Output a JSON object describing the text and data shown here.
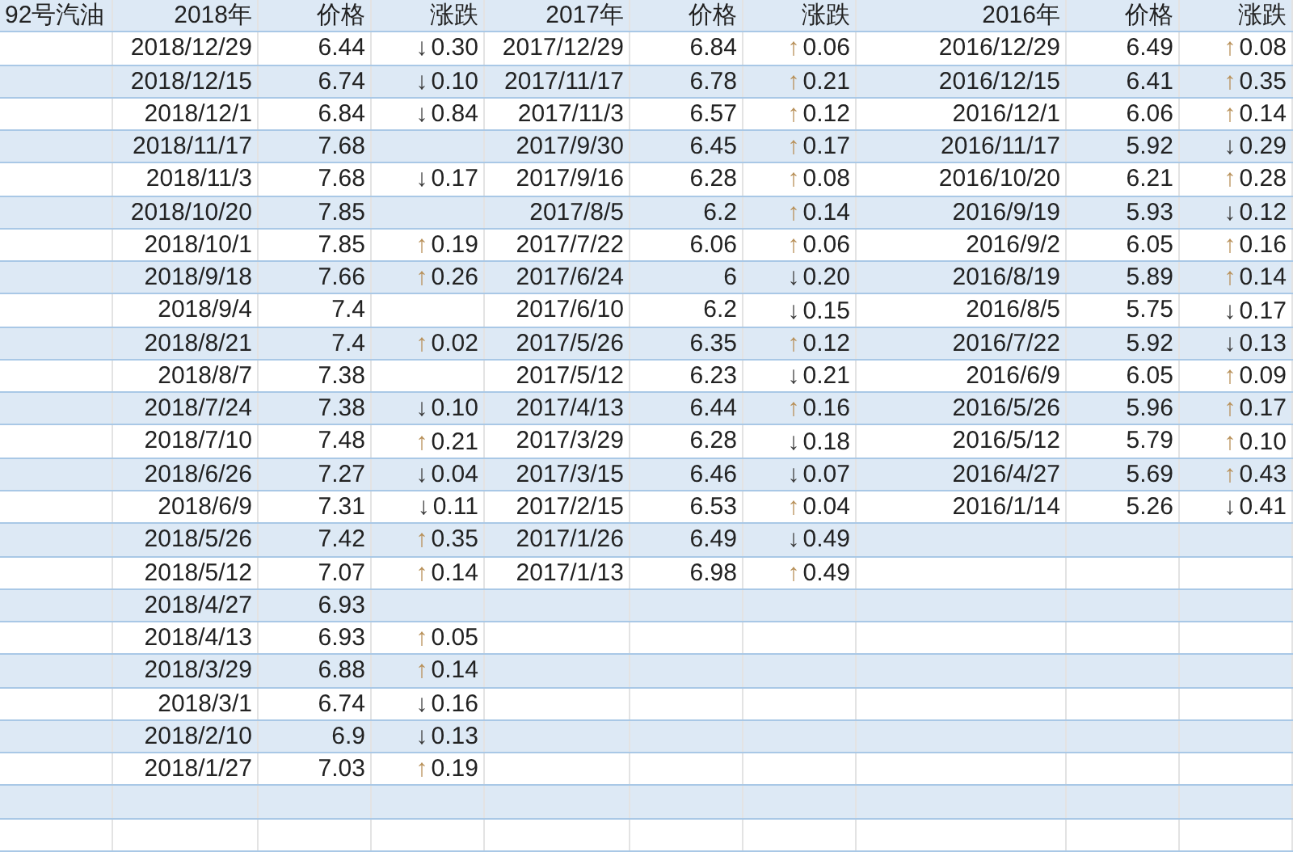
{
  "corner_label": "92号汽油",
  "sections": [
    {
      "date_header": "2018年",
      "price_header": "价格",
      "change_header": "涨跌",
      "rows": [
        {
          "date": "2018/12/29",
          "price": "6.44",
          "change": {
            "kind": "down",
            "arrow": "↓",
            "value": "0.30"
          }
        },
        {
          "date": "2018/12/15",
          "price": "6.74",
          "change": {
            "kind": "down",
            "arrow": "↓",
            "value": "0.10"
          }
        },
        {
          "date": "2018/12/1",
          "price": "6.84",
          "change": {
            "kind": "down",
            "arrow": "↓",
            "value": "0.84"
          }
        },
        {
          "date": "2018/11/17",
          "price": "7.68"
        },
        {
          "date": "2018/11/3",
          "price": "7.68",
          "change": {
            "kind": "down",
            "arrow": "↓",
            "value": "0.17"
          }
        },
        {
          "date": "2018/10/20",
          "price": "7.85"
        },
        {
          "date": "2018/10/1",
          "price": "7.85",
          "change": {
            "kind": "up",
            "arrow": "↑",
            "value": "0.19"
          }
        },
        {
          "date": "2018/9/18",
          "price": "7.66",
          "change": {
            "kind": "up",
            "arrow": "↑",
            "value": "0.26"
          }
        },
        {
          "date": "2018/9/4",
          "price": "7.4"
        },
        {
          "date": "2018/8/21",
          "price": "7.4",
          "change": {
            "kind": "up",
            "arrow": "↑",
            "value": "0.02"
          }
        },
        {
          "date": "2018/8/7",
          "price": "7.38"
        },
        {
          "date": "2018/7/24",
          "price": "7.38",
          "change": {
            "kind": "down",
            "arrow": "↓",
            "value": "0.10"
          }
        },
        {
          "date": "2018/7/10",
          "price": "7.48",
          "change": {
            "kind": "up",
            "arrow": "↑",
            "value": "0.21"
          }
        },
        {
          "date": "2018/6/26",
          "price": "7.27",
          "change": {
            "kind": "down",
            "arrow": "↓",
            "value": "0.04"
          }
        },
        {
          "date": "2018/6/9",
          "price": "7.31",
          "change": {
            "kind": "down",
            "arrow": "↓",
            "value": "0.11"
          }
        },
        {
          "date": "2018/5/26",
          "price": "7.42",
          "change": {
            "kind": "up",
            "arrow": "↑",
            "value": "0.35"
          }
        },
        {
          "date": "2018/5/12",
          "price": "7.07",
          "change": {
            "kind": "up",
            "arrow": "↑",
            "value": "0.14"
          }
        },
        {
          "date": "2018/4/27",
          "price": "6.93"
        },
        {
          "date": "2018/4/13",
          "price": "6.93",
          "change": {
            "kind": "up",
            "arrow": "↑",
            "value": "0.05"
          }
        },
        {
          "date": "2018/3/29",
          "price": "6.88",
          "change": {
            "kind": "up",
            "arrow": "↑",
            "value": "0.14"
          }
        },
        {
          "date": "2018/3/1",
          "price": "6.74",
          "change": {
            "kind": "down",
            "arrow": "↓",
            "value": "0.16"
          }
        },
        {
          "date": "2018/2/10",
          "price": "6.9",
          "change": {
            "kind": "down",
            "arrow": "↓",
            "value": "0.13"
          }
        },
        {
          "date": "2018/1/27",
          "price": "7.03",
          "change": {
            "kind": "up",
            "arrow": "↑",
            "value": "0.19"
          }
        }
      ]
    },
    {
      "date_header": "2017年",
      "price_header": "价格",
      "change_header": "涨跌",
      "rows": [
        {
          "date": "2017/12/29",
          "price": "6.84",
          "change": {
            "kind": "up",
            "arrow": "↑",
            "value": "0.06"
          }
        },
        {
          "date": "2017/11/17",
          "price": "6.78",
          "change": {
            "kind": "up",
            "arrow": "↑",
            "value": "0.21"
          }
        },
        {
          "date": "2017/11/3",
          "price": "6.57",
          "change": {
            "kind": "up",
            "arrow": "↑",
            "value": "0.12"
          }
        },
        {
          "date": "2017/9/30",
          "price": "6.45",
          "change": {
            "kind": "up",
            "arrow": "↑",
            "value": "0.17"
          }
        },
        {
          "date": "2017/9/16",
          "price": "6.28",
          "change": {
            "kind": "up",
            "arrow": "↑",
            "value": "0.08"
          }
        },
        {
          "date": "2017/8/5",
          "price": "6.2",
          "change": {
            "kind": "up",
            "arrow": "↑",
            "value": "0.14"
          }
        },
        {
          "date": "2017/7/22",
          "price": "6.06",
          "change": {
            "kind": "up",
            "arrow": "↑",
            "value": "0.06"
          }
        },
        {
          "date": "2017/6/24",
          "price": "6",
          "change": {
            "kind": "down",
            "arrow": "↓",
            "value": "0.20"
          }
        },
        {
          "date": "2017/6/10",
          "price": "6.2",
          "change": {
            "kind": "down",
            "arrow": "↓",
            "value": "0.15"
          }
        },
        {
          "date": "2017/5/26",
          "price": "6.35",
          "change": {
            "kind": "up",
            "arrow": "↑",
            "value": "0.12"
          }
        },
        {
          "date": "2017/5/12",
          "price": "6.23",
          "change": {
            "kind": "down",
            "arrow": "↓",
            "value": "0.21"
          }
        },
        {
          "date": "2017/4/13",
          "price": "6.44",
          "change": {
            "kind": "up",
            "arrow": "↑",
            "value": "0.16"
          }
        },
        {
          "date": "2017/3/29",
          "price": "6.28",
          "change": {
            "kind": "down",
            "arrow": "↓",
            "value": "0.18"
          }
        },
        {
          "date": "2017/3/15",
          "price": "6.46",
          "change": {
            "kind": "down",
            "arrow": "↓",
            "value": "0.07"
          }
        },
        {
          "date": "2017/2/15",
          "price": "6.53",
          "change": {
            "kind": "up",
            "arrow": "↑",
            "value": "0.04"
          }
        },
        {
          "date": "2017/1/26",
          "price": "6.49",
          "change": {
            "kind": "down",
            "arrow": "↓",
            "value": "0.49"
          }
        },
        {
          "date": "2017/1/13",
          "price": "6.98",
          "change": {
            "kind": "up",
            "arrow": "↑",
            "value": "0.49"
          }
        }
      ]
    },
    {
      "date_header": "2016年",
      "price_header": "价格",
      "change_header": "涨跌",
      "rows": [
        {
          "date": "2016/12/29",
          "price": "6.49",
          "change": {
            "kind": "up",
            "arrow": "↑",
            "value": "0.08"
          }
        },
        {
          "date": "2016/12/15",
          "price": "6.41",
          "change": {
            "kind": "up",
            "arrow": "↑",
            "value": "0.35"
          }
        },
        {
          "date": "2016/12/1",
          "price": "6.06",
          "change": {
            "kind": "up",
            "arrow": "↑",
            "value": "0.14"
          }
        },
        {
          "date": "2016/11/17",
          "price": "5.92",
          "change": {
            "kind": "down",
            "arrow": "↓",
            "value": "0.29"
          }
        },
        {
          "date": "2016/10/20",
          "price": "6.21",
          "change": {
            "kind": "up",
            "arrow": "↑",
            "value": "0.28"
          }
        },
        {
          "date": "2016/9/19",
          "price": "5.93",
          "change": {
            "kind": "down",
            "arrow": "↓",
            "value": "0.12"
          }
        },
        {
          "date": "2016/9/2",
          "price": "6.05",
          "change": {
            "kind": "up",
            "arrow": "↑",
            "value": "0.16"
          }
        },
        {
          "date": "2016/8/19",
          "price": "5.89",
          "change": {
            "kind": "up",
            "arrow": "↑",
            "value": "0.14"
          }
        },
        {
          "date": "2016/8/5",
          "price": "5.75",
          "change": {
            "kind": "down",
            "arrow": "↓",
            "value": "0.17"
          }
        },
        {
          "date": "2016/7/22",
          "price": "5.92",
          "change": {
            "kind": "down",
            "arrow": "↓",
            "value": "0.13"
          }
        },
        {
          "date": "2016/6/9",
          "price": "6.05",
          "change": {
            "kind": "up",
            "arrow": "↑",
            "value": "0.09"
          }
        },
        {
          "date": "2016/5/26",
          "price": "5.96",
          "change": {
            "kind": "up",
            "arrow": "↑",
            "value": "0.17"
          }
        },
        {
          "date": "2016/5/12",
          "price": "5.79",
          "change": {
            "kind": "up",
            "arrow": "↑",
            "value": "0.10"
          }
        },
        {
          "date": "2016/4/27",
          "price": "5.69",
          "change": {
            "kind": "up",
            "arrow": "↑",
            "value": "0.43"
          }
        },
        {
          "date": "2016/1/14",
          "price": "5.26",
          "change": {
            "kind": "down",
            "arrow": "↓",
            "value": "0.41"
          }
        }
      ]
    }
  ]
}
